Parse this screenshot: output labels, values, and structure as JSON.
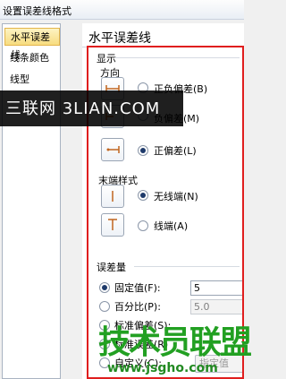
{
  "window": {
    "title": "设置误差线格式"
  },
  "sidebar": {
    "items": [
      {
        "label": "水平误差线",
        "selected": true
      },
      {
        "label": "线条颜色",
        "selected": false
      },
      {
        "label": "线型",
        "selected": false
      }
    ]
  },
  "panel": {
    "heading": "水平误差线",
    "display": {
      "group_label": "显示",
      "direction_label": "方向",
      "options": [
        {
          "label": "正负偏差(B)",
          "checked": false
        },
        {
          "label": "负偏差(M)",
          "checked": false
        },
        {
          "label": "正偏差(L)",
          "checked": true
        }
      ],
      "end_style_label": "末端样式",
      "end_options": [
        {
          "label": "无线端(N)",
          "checked": true
        },
        {
          "label": "线端(A)",
          "checked": false
        }
      ]
    },
    "amount": {
      "group_label": "误差量",
      "options": [
        {
          "label": "固定值(F):",
          "checked": true,
          "value": "5"
        },
        {
          "label": "百分比(P):",
          "checked": false,
          "value": "5.0"
        },
        {
          "label": "标准偏差(S):",
          "checked": false
        },
        {
          "label": "标准误差(R)",
          "checked": false
        },
        {
          "label": "自定义(C):",
          "checked": false
        }
      ],
      "specify_button": "指定值(V)"
    }
  },
  "overlay": {
    "text": "三联网 3LIAN.COM"
  },
  "watermark": {
    "text": "技术员联盟",
    "url": "www.jsgho.com"
  }
}
